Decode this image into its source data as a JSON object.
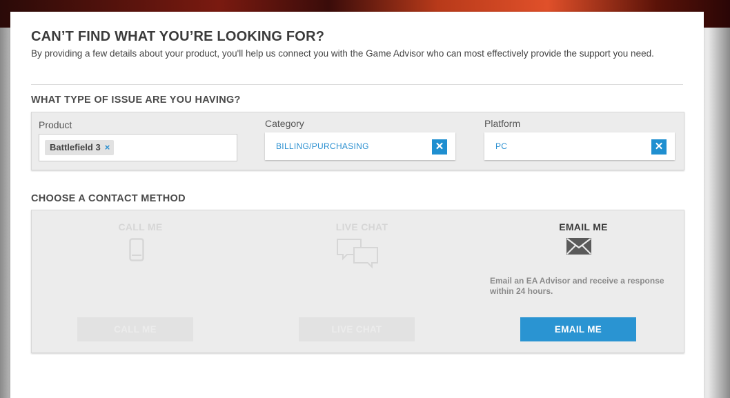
{
  "header": {
    "title": "CAN’T FIND WHAT YOU’RE LOOKING FOR?",
    "intro": "By providing a few details about your product, you'll help us connect you with the Game Advisor who can most effectively provide the support you need."
  },
  "issue": {
    "title": "WHAT TYPE OF ISSUE ARE YOU HAVING?",
    "product": {
      "label": "Product",
      "tag": "Battlefield 3",
      "remove": "×"
    },
    "category": {
      "label": "Category",
      "value": "BILLING/PURCHASING",
      "clear": "✕"
    },
    "platform": {
      "label": "Platform",
      "value": "PC",
      "clear": "✕"
    }
  },
  "contact": {
    "title": "CHOOSE A CONTACT METHOD",
    "call": {
      "title": "CALL ME",
      "button": "CALL ME",
      "icon": "mobile-phone-icon"
    },
    "chat": {
      "title": "LIVE CHAT",
      "button": "LIVE CHAT",
      "icon": "chat-bubbles-icon"
    },
    "email": {
      "title": "EMAIL ME",
      "button": "EMAIL ME",
      "icon": "envelope-icon",
      "description": "Email an EA Advisor and receive a response within 24 hours."
    }
  },
  "colors": {
    "accent": "#2a94d2",
    "disabled_text": "#d6d6d6"
  }
}
